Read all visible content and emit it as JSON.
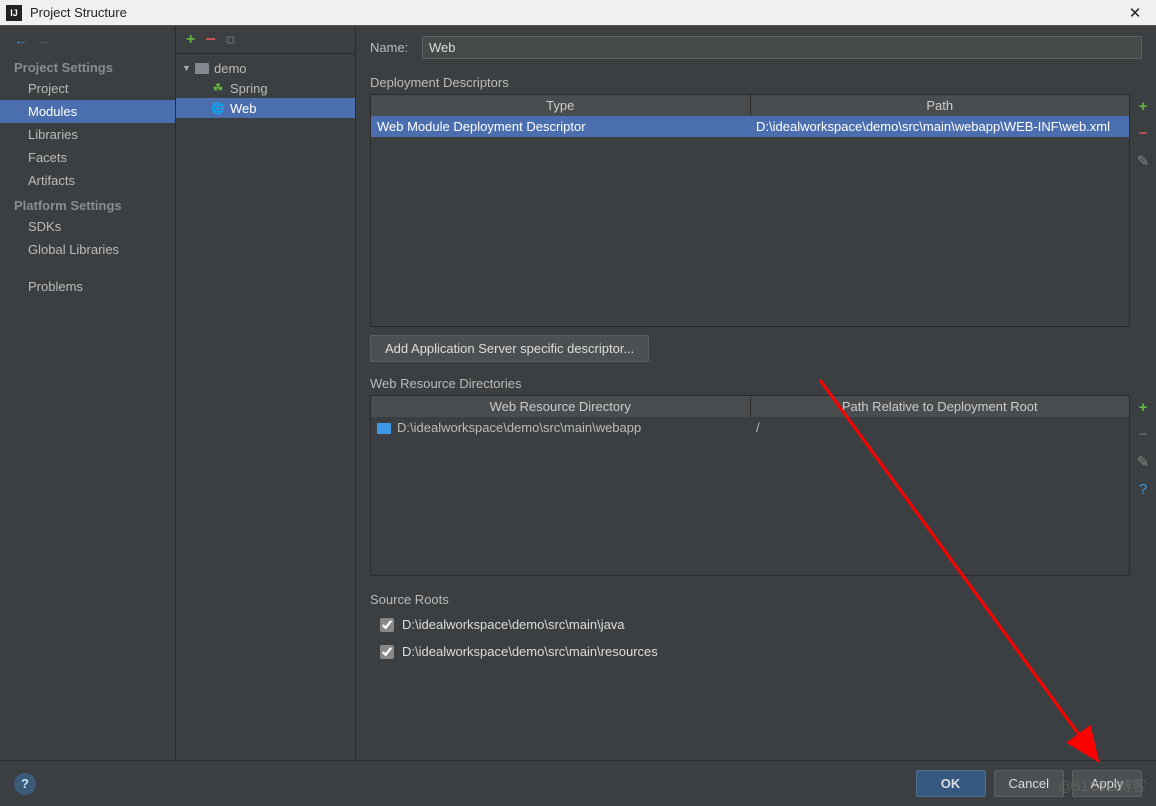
{
  "window": {
    "title": "Project Structure"
  },
  "sidebar": {
    "section1": "Project Settings",
    "items1": [
      "Project",
      "Modules",
      "Libraries",
      "Facets",
      "Artifacts"
    ],
    "selected1": 1,
    "section2": "Platform Settings",
    "items2": [
      "SDKs",
      "Global Libraries"
    ],
    "items3": [
      "Problems"
    ]
  },
  "tree": {
    "root": "demo",
    "children": [
      {
        "label": "Spring",
        "icon": "spring"
      },
      {
        "label": "Web",
        "icon": "web",
        "selected": true
      }
    ]
  },
  "form": {
    "name_label": "Name:",
    "name_value": "Web",
    "deploy_section": "Deployment Descriptors",
    "deploy_headers": [
      "Type",
      "Path"
    ],
    "deploy_rows": [
      {
        "type": "Web Module Deployment Descriptor",
        "path": "D:\\idealworkspace\\demo\\src\\main\\webapp\\WEB-INF\\web.xml",
        "selected": true
      }
    ],
    "add_descriptor_btn": "Add Application Server specific descriptor...",
    "webres_section": "Web Resource Directories",
    "webres_headers": [
      "Web Resource Directory",
      "Path Relative to Deployment Root"
    ],
    "webres_rows": [
      {
        "dir": "D:\\idealworkspace\\demo\\src\\main\\webapp",
        "path": "/"
      }
    ],
    "source_section": "Source Roots",
    "source_roots": [
      {
        "checked": true,
        "path": "D:\\idealworkspace\\demo\\src\\main\\java"
      },
      {
        "checked": true,
        "path": "D:\\idealworkspace\\demo\\src\\main\\resources"
      }
    ]
  },
  "footer": {
    "ok": "OK",
    "cancel": "Cancel",
    "apply": "Apply"
  },
  "watermark": "@51CTO博客"
}
